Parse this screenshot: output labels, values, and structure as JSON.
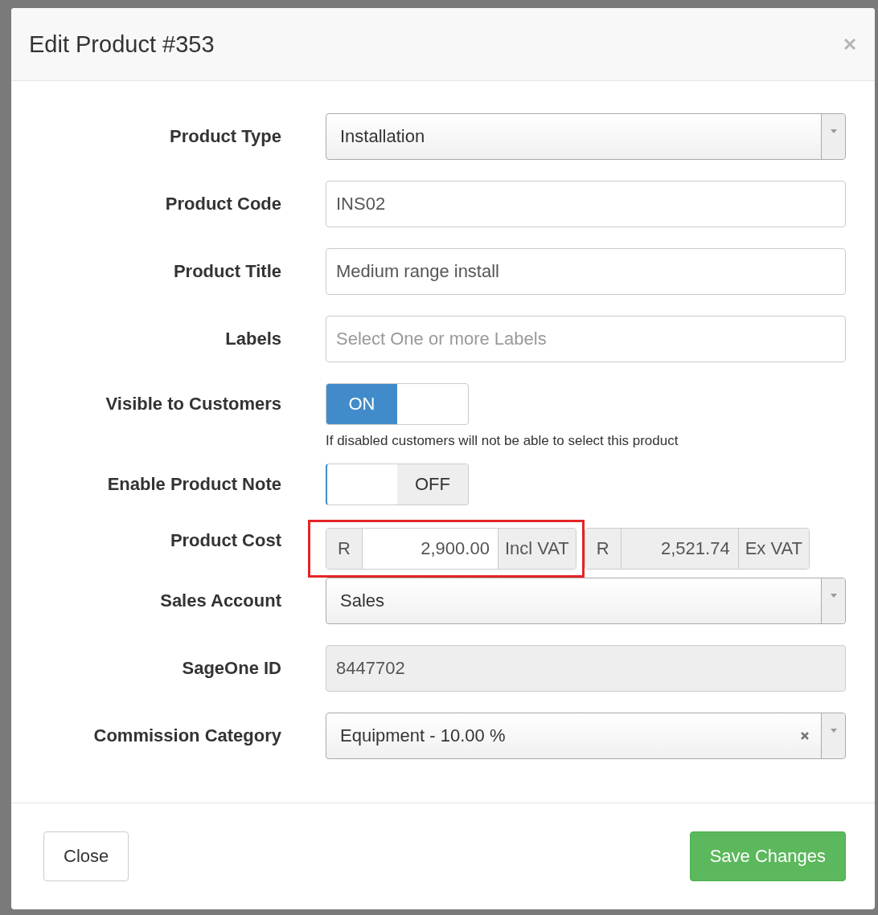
{
  "modal": {
    "title": "Edit Product #353"
  },
  "fields": [
    {
      "kind": "select",
      "label": "Product Type",
      "value": "Installation",
      "clearable": false
    },
    {
      "kind": "text",
      "label": "Product Code",
      "value": "INS02",
      "disabled": false
    },
    {
      "kind": "text",
      "label": "Product Title",
      "value": "Medium range install",
      "disabled": false
    },
    {
      "kind": "text",
      "label": "Labels",
      "placeholder": "Select One or more Labels",
      "disabled": false
    },
    {
      "kind": "toggle",
      "label": "Visible to Customers",
      "on": true,
      "text": "ON",
      "help": "If disabled customers will not be able to select this product"
    },
    {
      "kind": "toggle",
      "label": "Enable Product Note",
      "on": false,
      "text": "OFF"
    },
    {
      "kind": "cost",
      "label": "Product Cost",
      "groups": [
        {
          "prefix": "R",
          "value": "2,900.00",
          "suffix": "Incl VAT",
          "highlighted": true,
          "disabled": false
        },
        {
          "prefix": "R",
          "value": "2,521.74",
          "suffix": "Ex VAT",
          "highlighted": false,
          "disabled": true
        }
      ]
    },
    {
      "kind": "select",
      "label": "Sales Account",
      "value": "Sales",
      "clearable": false
    },
    {
      "kind": "text",
      "label": "SageOne ID",
      "value": "8447702",
      "disabled": true
    },
    {
      "kind": "select",
      "label": "Commission Category",
      "value": "Equipment - 10.00 %",
      "clearable": true
    }
  ],
  "buttons": [
    {
      "label": "Close",
      "kind": "default"
    },
    {
      "label": "Save Changes",
      "kind": "primary"
    }
  ]
}
